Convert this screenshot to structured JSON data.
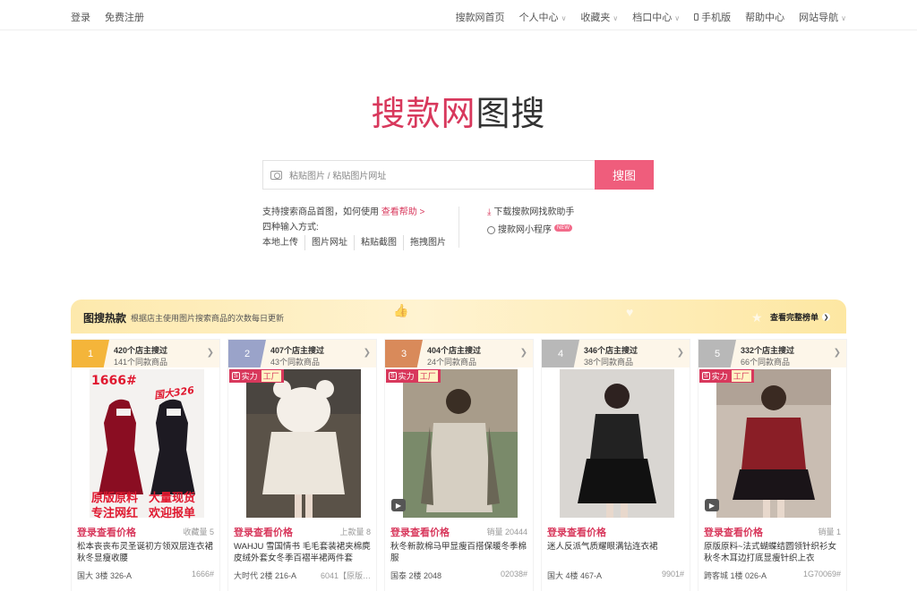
{
  "topbar": {
    "left": [
      "登录",
      "免费注册"
    ],
    "right": [
      {
        "label": "搜款网首页",
        "caret": false
      },
      {
        "label": "个人中心",
        "caret": true
      },
      {
        "label": "收藏夹",
        "caret": true
      },
      {
        "label": "档口中心",
        "caret": true
      },
      {
        "label": "手机版",
        "caret": false
      },
      {
        "label": "帮助中心",
        "caret": false
      },
      {
        "label": "网站导航",
        "caret": true
      }
    ]
  },
  "logo": {
    "brand": "搜款网",
    "suffix": "图搜"
  },
  "search": {
    "placeholder": "粘贴图片 / 粘贴图片网址",
    "button": "搜图"
  },
  "help": {
    "line1_prefix": "支持搜索商品首图，如何使用",
    "line1_link": "查看帮助 >",
    "line2": "四种输入方式:",
    "methods": [
      "本地上传",
      "图片网址",
      "粘贴截图",
      "拖拽图片"
    ]
  },
  "tools": {
    "download": "下载搜款网找款助手",
    "mini": "搜款网小程序",
    "new_badge": "NEW"
  },
  "hot": {
    "title": "图搜热款",
    "subtitle": "根据店主使用图片搜索商品的次数每日更新",
    "more": "查看完整榜单"
  },
  "cards": [
    {
      "rank": "1",
      "medal_color": "#f4b53a",
      "stores": "420个店主搜过",
      "same": "141个同款商品",
      "badge": false,
      "video": false,
      "price": "登录查看价格",
      "stat": "收藏量 5",
      "desc": "松本丧丧布灵圣诞初方领双层连衣裙秋冬显瘦收腰",
      "addr": "国大 3楼 326-A",
      "code": "1666#",
      "overlay": {
        "tl": "1666#",
        "tr": "国大326",
        "b1": "原版原料",
        "b2": "大量现货",
        "b3": "专注网红",
        "b4": "欢迎报单"
      }
    },
    {
      "rank": "2",
      "medal_color": "#9aa3c9",
      "stores": "407个店主搜过",
      "same": "43个同款商品",
      "badge": true,
      "video": false,
      "price": "登录查看价格",
      "stat": "上款量 8",
      "desc": "WAHJU 雪国情书 毛毛套装裙夹棉麂皮绒外套女冬季百褶半裙两件套",
      "addr": "大时代 2楼 216-A",
      "code": "6041【原版…"
    },
    {
      "rank": "3",
      "medal_color": "#d98a5a",
      "stores": "404个店主搜过",
      "same": "24个同款商品",
      "badge": true,
      "video": true,
      "price": "登录查看价格",
      "stat": "销量 20444",
      "desc": "秋冬新款棉马甲显瘦百搭保暖冬季棉服",
      "addr": "国泰 2楼 2048",
      "code": "02038#"
    },
    {
      "rank": "4",
      "medal_color": "#b8b8b8",
      "stores": "346个店主搜过",
      "same": "38个同款商品",
      "badge": false,
      "video": false,
      "price": "登录查看价格",
      "stat": "",
      "desc": "迷人反派气质耀眼满钻连衣裙",
      "addr": "国大 4楼 467-A",
      "code": "9901#"
    },
    {
      "rank": "5",
      "medal_color": "#b8b8b8",
      "stores": "332个店主搜过",
      "same": "66个同款商品",
      "badge": true,
      "video": true,
      "price": "登录查看价格",
      "stat": "销量 1",
      "desc": "原版原料~法式蝴蝶结圆领针织衫女秋冬木耳边打底显瘦针织上衣",
      "addr": "跨客城 1楼 026-A",
      "code": "1G70069#"
    }
  ],
  "badge_text": {
    "shili": "实力",
    "gongchang": "工厂"
  }
}
